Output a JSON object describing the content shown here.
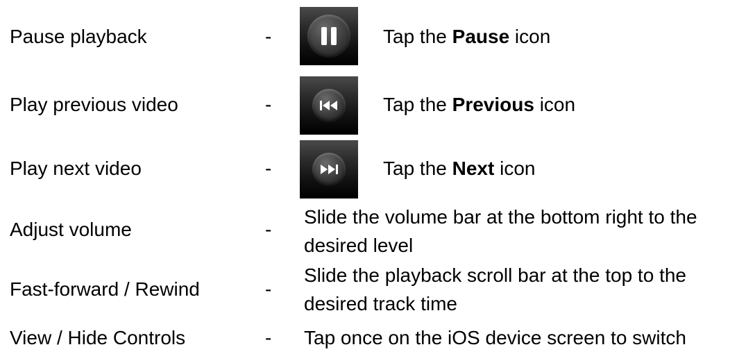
{
  "rows": [
    {
      "action": "Pause playback",
      "dash": "-",
      "icon": "pause-icon",
      "desc_prefix": "Tap the ",
      "desc_bold": "Pause",
      "desc_suffix": " icon"
    },
    {
      "action": "Play previous video",
      "dash": "-",
      "icon": "previous-track-icon",
      "desc_prefix": "Tap the ",
      "desc_bold": "Previous",
      "desc_suffix": " icon"
    },
    {
      "action": "Play next video",
      "dash": "-",
      "icon": "next-track-icon",
      "desc_prefix": "Tap the ",
      "desc_bold": "Next",
      "desc_suffix": " icon"
    },
    {
      "action": "Adjust volume",
      "dash": "-",
      "desc_line1": "Slide the volume bar at the bottom right to the",
      "desc_line2": "desired level"
    },
    {
      "action": "Fast-forward / Rewind",
      "dash": "-",
      "desc_line1": "Slide the playback scroll bar at the top to the",
      "desc_line2": "desired track time"
    },
    {
      "action": "View / Hide Controls",
      "dash": "-",
      "desc_line1": "Tap once on the iOS device screen to switch"
    }
  ],
  "colors": {
    "text": "#000000",
    "background": "#ffffff"
  }
}
